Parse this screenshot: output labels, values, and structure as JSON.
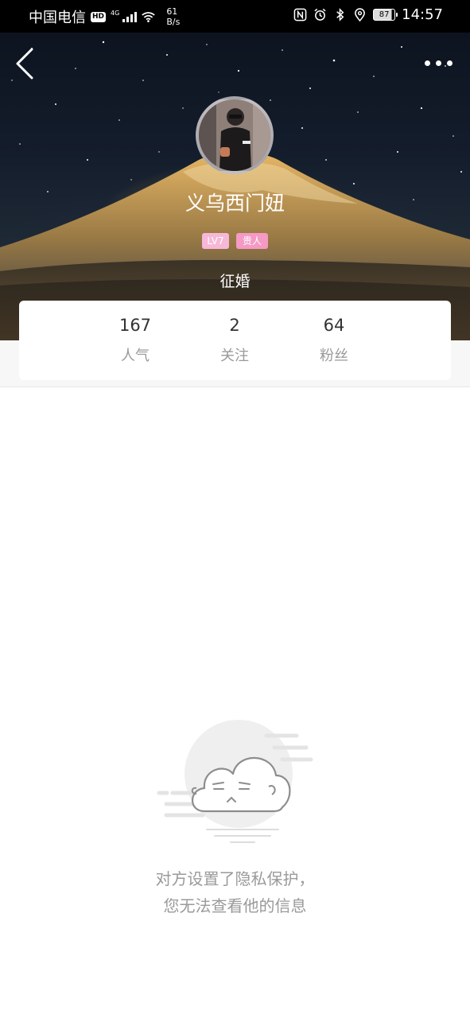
{
  "status_bar": {
    "carrier": "中国电信",
    "hd": "HD",
    "network": "4G",
    "speed_value": "61",
    "speed_unit": "B/s",
    "battery": "87",
    "time": "14:57"
  },
  "profile": {
    "username": "义乌西门妞",
    "level_tag": "LV7",
    "vip_tag": "贵人",
    "bio": "征婚"
  },
  "stats": [
    {
      "value": "167",
      "label": "人气"
    },
    {
      "value": "2",
      "label": "关注"
    },
    {
      "value": "64",
      "label": "粉丝"
    }
  ],
  "empty_state": {
    "line1": "对方设置了隐私保护，",
    "line2": "您无法查看他的信息"
  },
  "colors": {
    "accent_pink": "#f59ac4",
    "text_muted": "#9a9a9a"
  },
  "icons": [
    "back-arrow-icon",
    "more-dots-icon",
    "nfc-icon",
    "alarm-icon",
    "bluetooth-icon",
    "location-icon",
    "sleepy-cloud-illustration"
  ]
}
